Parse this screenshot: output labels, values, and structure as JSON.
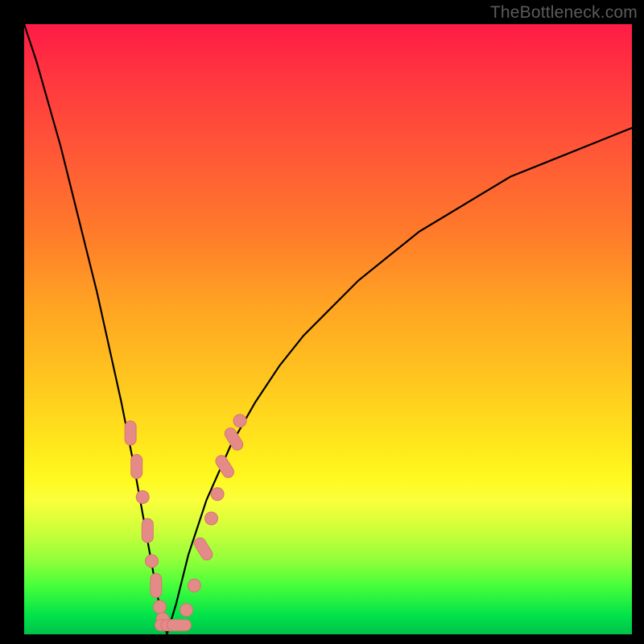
{
  "watermark": "TheBottleneck.com",
  "colors": {
    "bg_black": "#000000",
    "gradient_top": "#ff1b46",
    "gradient_mid": "#ffe41c",
    "gradient_bottom": "#00c24a",
    "curve": "#000000",
    "marker_fill": "#e58b87",
    "marker_stroke": "#d47673"
  },
  "chart_data": {
    "type": "line",
    "title": "",
    "xlabel": "",
    "ylabel": "",
    "xlim": [
      0,
      100
    ],
    "ylim": [
      0,
      100
    ],
    "grid": false,
    "series": [
      {
        "name": "bottleneck-curve",
        "x": [
          0,
          2,
          4,
          6,
          8,
          10,
          12,
          14,
          16,
          18,
          20,
          22,
          23.5,
          25,
          27,
          30,
          34,
          38,
          42,
          46,
          50,
          55,
          60,
          65,
          70,
          75,
          80,
          85,
          90,
          95,
          100
        ],
        "values": [
          100,
          94,
          87,
          80,
          72,
          64,
          56,
          47,
          38,
          28,
          17,
          6,
          0,
          5,
          13,
          22,
          31,
          38,
          44,
          49,
          53,
          58,
          62,
          66,
          69,
          72,
          75,
          77,
          79,
          81,
          83
        ]
      }
    ],
    "markers": {
      "name": "highlight-points",
      "points": [
        {
          "x": 17.5,
          "y": 33.0,
          "shape": "pill-v"
        },
        {
          "x": 18.5,
          "y": 27.5,
          "shape": "pill-v"
        },
        {
          "x": 19.5,
          "y": 22.5,
          "shape": "circle"
        },
        {
          "x": 20.3,
          "y": 17.0,
          "shape": "pill-v"
        },
        {
          "x": 21.0,
          "y": 12.0,
          "shape": "circle"
        },
        {
          "x": 21.7,
          "y": 8.0,
          "shape": "pill-v"
        },
        {
          "x": 22.3,
          "y": 4.5,
          "shape": "circle"
        },
        {
          "x": 22.8,
          "y": 2.5,
          "shape": "circle"
        },
        {
          "x": 23.5,
          "y": 1.5,
          "shape": "pill-h"
        },
        {
          "x": 24.5,
          "y": 1.5,
          "shape": "pill-h"
        },
        {
          "x": 25.5,
          "y": 1.5,
          "shape": "pill-h"
        },
        {
          "x": 26.7,
          "y": 4.0,
          "shape": "circle"
        },
        {
          "x": 28.0,
          "y": 8.0,
          "shape": "circle"
        },
        {
          "x": 29.5,
          "y": 14.0,
          "shape": "pill-d"
        },
        {
          "x": 30.8,
          "y": 19.0,
          "shape": "circle"
        },
        {
          "x": 31.8,
          "y": 23.0,
          "shape": "circle"
        },
        {
          "x": 33.0,
          "y": 27.5,
          "shape": "pill-d"
        },
        {
          "x": 34.5,
          "y": 32.0,
          "shape": "pill-d"
        },
        {
          "x": 35.5,
          "y": 35.0,
          "shape": "circle"
        }
      ]
    }
  }
}
